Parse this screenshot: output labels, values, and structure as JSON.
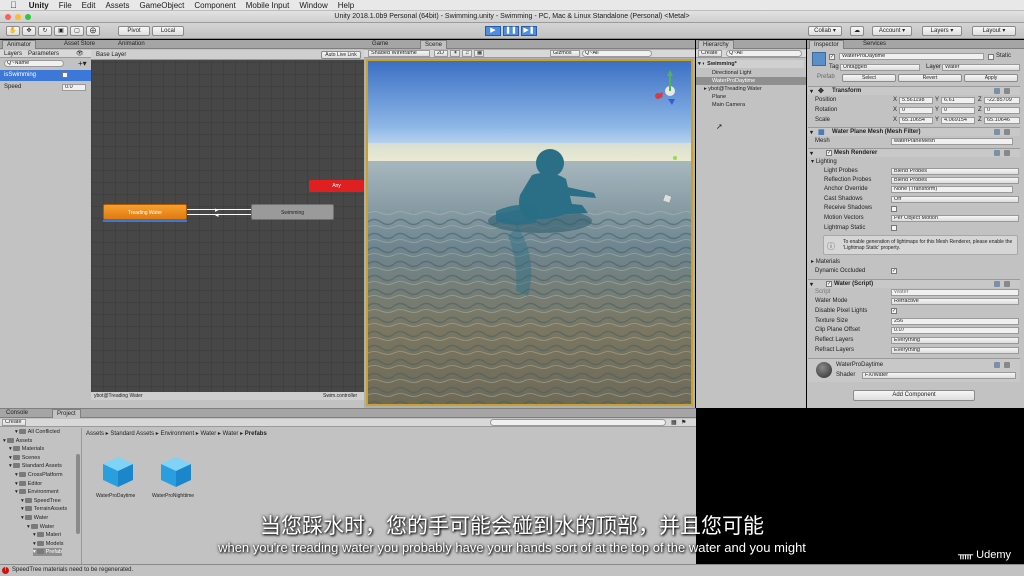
{
  "menubar": {
    "app": "Unity",
    "items": [
      "File",
      "Edit",
      "Assets",
      "GameObject",
      "Component",
      "Mobile Input",
      "Window",
      "Help"
    ]
  },
  "window_title": "Unity 2018.1.0b9 Personal (64bit) - Swimming.unity - Swimming - PC, Mac & Linux Standalone (Personal) <Metal>",
  "toolbar": {
    "pivot": "Pivot",
    "local": "Local",
    "collab": "Collab",
    "account": "Account",
    "layers": "Layers",
    "layout": "Layout"
  },
  "animator": {
    "tabs": [
      "Animator",
      "Asset Store",
      "Animation"
    ],
    "subtabs": [
      "Layers",
      "Parameters"
    ],
    "search_placeholder": "Q~Name",
    "base_layer": "Base Layer",
    "auto_live_link": "Auto Live Link",
    "params": [
      {
        "name": "isSwimming",
        "value": ""
      },
      {
        "name": "Speed",
        "value": "0.0"
      }
    ],
    "states": {
      "treading": "Treading Water",
      "swimming": "Swimming",
      "red": "Any"
    },
    "footer_left": "ybot@Treading Water",
    "footer_right": "Swim.controller"
  },
  "scene": {
    "tabs": [
      "Game",
      "Scene"
    ],
    "shading": "Shaded Wireframe",
    "mode_2d": "2D",
    "gizmos": "Gizmos",
    "search_placeholder": "Q~All"
  },
  "hierarchy": {
    "tab": "Hierarchy",
    "create": "Create",
    "search_placeholder": "Q~All",
    "scene_name": "Swimming*",
    "items": [
      "Directional Light",
      "WaterProDaytime",
      "ybot@Treading Water",
      "Plane",
      "Main Camera"
    ]
  },
  "inspector": {
    "tabs": [
      "Inspector",
      "Services"
    ],
    "object_name": "WaterProDaytime",
    "static_label": "Static",
    "tag_label": "Tag",
    "tag_value": "Untagged",
    "layer_label": "Layer",
    "layer_value": "Water",
    "prefab_label": "Prefab",
    "prefab_select": "Select",
    "prefab_revert": "Revert",
    "prefab_apply": "Apply",
    "transform": {
      "title": "Transform",
      "rows": [
        {
          "label": "Position",
          "x": "5.561198",
          "y": "6.61",
          "z": "-22.85709"
        },
        {
          "label": "Rotation",
          "x": "0",
          "y": "0",
          "z": "0"
        },
        {
          "label": "Scale",
          "x": "65.10654",
          "y": "4.069154",
          "z": "65.10646"
        }
      ]
    },
    "mesh_filter": {
      "title": "Water Plane Mesh (Mesh Filter)",
      "mesh_label": "Mesh",
      "mesh_value": "waterPlaneMesh"
    },
    "mesh_renderer": {
      "title": "Mesh Renderer",
      "lighting": "Lighting",
      "rows": [
        {
          "label": "Light Probes",
          "value": "Blend Probes"
        },
        {
          "label": "Reflection Probes",
          "value": "Blend Probes"
        },
        {
          "label": "Anchor Override",
          "value": "None (Transform)"
        },
        {
          "label": "Cast Shadows",
          "value": "Off"
        },
        {
          "label": "Receive Shadows",
          "value": ""
        },
        {
          "label": "Motion Vectors",
          "value": "Per Object Motion"
        },
        {
          "label": "Lightmap Static",
          "value": ""
        }
      ],
      "info": "To enable generation of lightmaps for this Mesh Renderer, please enable the 'Lightmap Static' property.",
      "materials": "Materials",
      "dynamic_occluded": "Dynamic Occluded"
    },
    "water_script": {
      "title": "Water (Script)",
      "rows": [
        {
          "label": "Script",
          "value": "Water"
        },
        {
          "label": "Water Mode",
          "value": "Refractive"
        },
        {
          "label": "Disable Pixel Lights",
          "value": ""
        },
        {
          "label": "Texture Size",
          "value": "256"
        },
        {
          "label": "Clip Plane Offset",
          "value": "0.07"
        },
        {
          "label": "Reflect Layers",
          "value": "Everything"
        },
        {
          "label": "Refract Layers",
          "value": "Everything"
        }
      ]
    },
    "material": {
      "name": "WaterProDaytime",
      "shader_label": "Shader",
      "shader_value": "FX/Water"
    },
    "add_component": "Add Component"
  },
  "project": {
    "tabs": [
      "Console",
      "Project"
    ],
    "create": "Create",
    "search_placeholder": "",
    "breadcrumb": [
      "Assets",
      "Standard Assets",
      "Environment",
      "Water",
      "Water",
      "Prefabs"
    ],
    "tree": [
      {
        "label": "All Conflicted",
        "indent": 2
      },
      {
        "label": "Assets",
        "indent": 0
      },
      {
        "label": "Materials",
        "indent": 1
      },
      {
        "label": "Scenes",
        "indent": 1
      },
      {
        "label": "Standard Assets",
        "indent": 1
      },
      {
        "label": "CrossPlatform",
        "indent": 2
      },
      {
        "label": "Editor",
        "indent": 2
      },
      {
        "label": "Environment",
        "indent": 2
      },
      {
        "label": "SpeedTree",
        "indent": 3
      },
      {
        "label": "TerrainAssets",
        "indent": 3
      },
      {
        "label": "Water",
        "indent": 3
      },
      {
        "label": "Water",
        "indent": 4
      },
      {
        "label": "Materi",
        "indent": 5
      },
      {
        "label": "Models",
        "indent": 5
      },
      {
        "label": "Prefab",
        "indent": 5
      }
    ],
    "assets": [
      "WaterProDaytime",
      "WaterProNighttime"
    ]
  },
  "status": "SpeedTree materials need to be regenerated.",
  "subtitles": {
    "chinese": "当您踩水时，您的手可能会碰到水的顶部，并且您可能",
    "english": "when you're treading water you probably have your hands sort of at the top of the water and you might"
  },
  "watermark": "Udemy",
  "colors": {
    "accent": "#3c78d8",
    "treading_node": "#f08a1c",
    "any_state": "#e02020",
    "status_error": "#d01010"
  }
}
